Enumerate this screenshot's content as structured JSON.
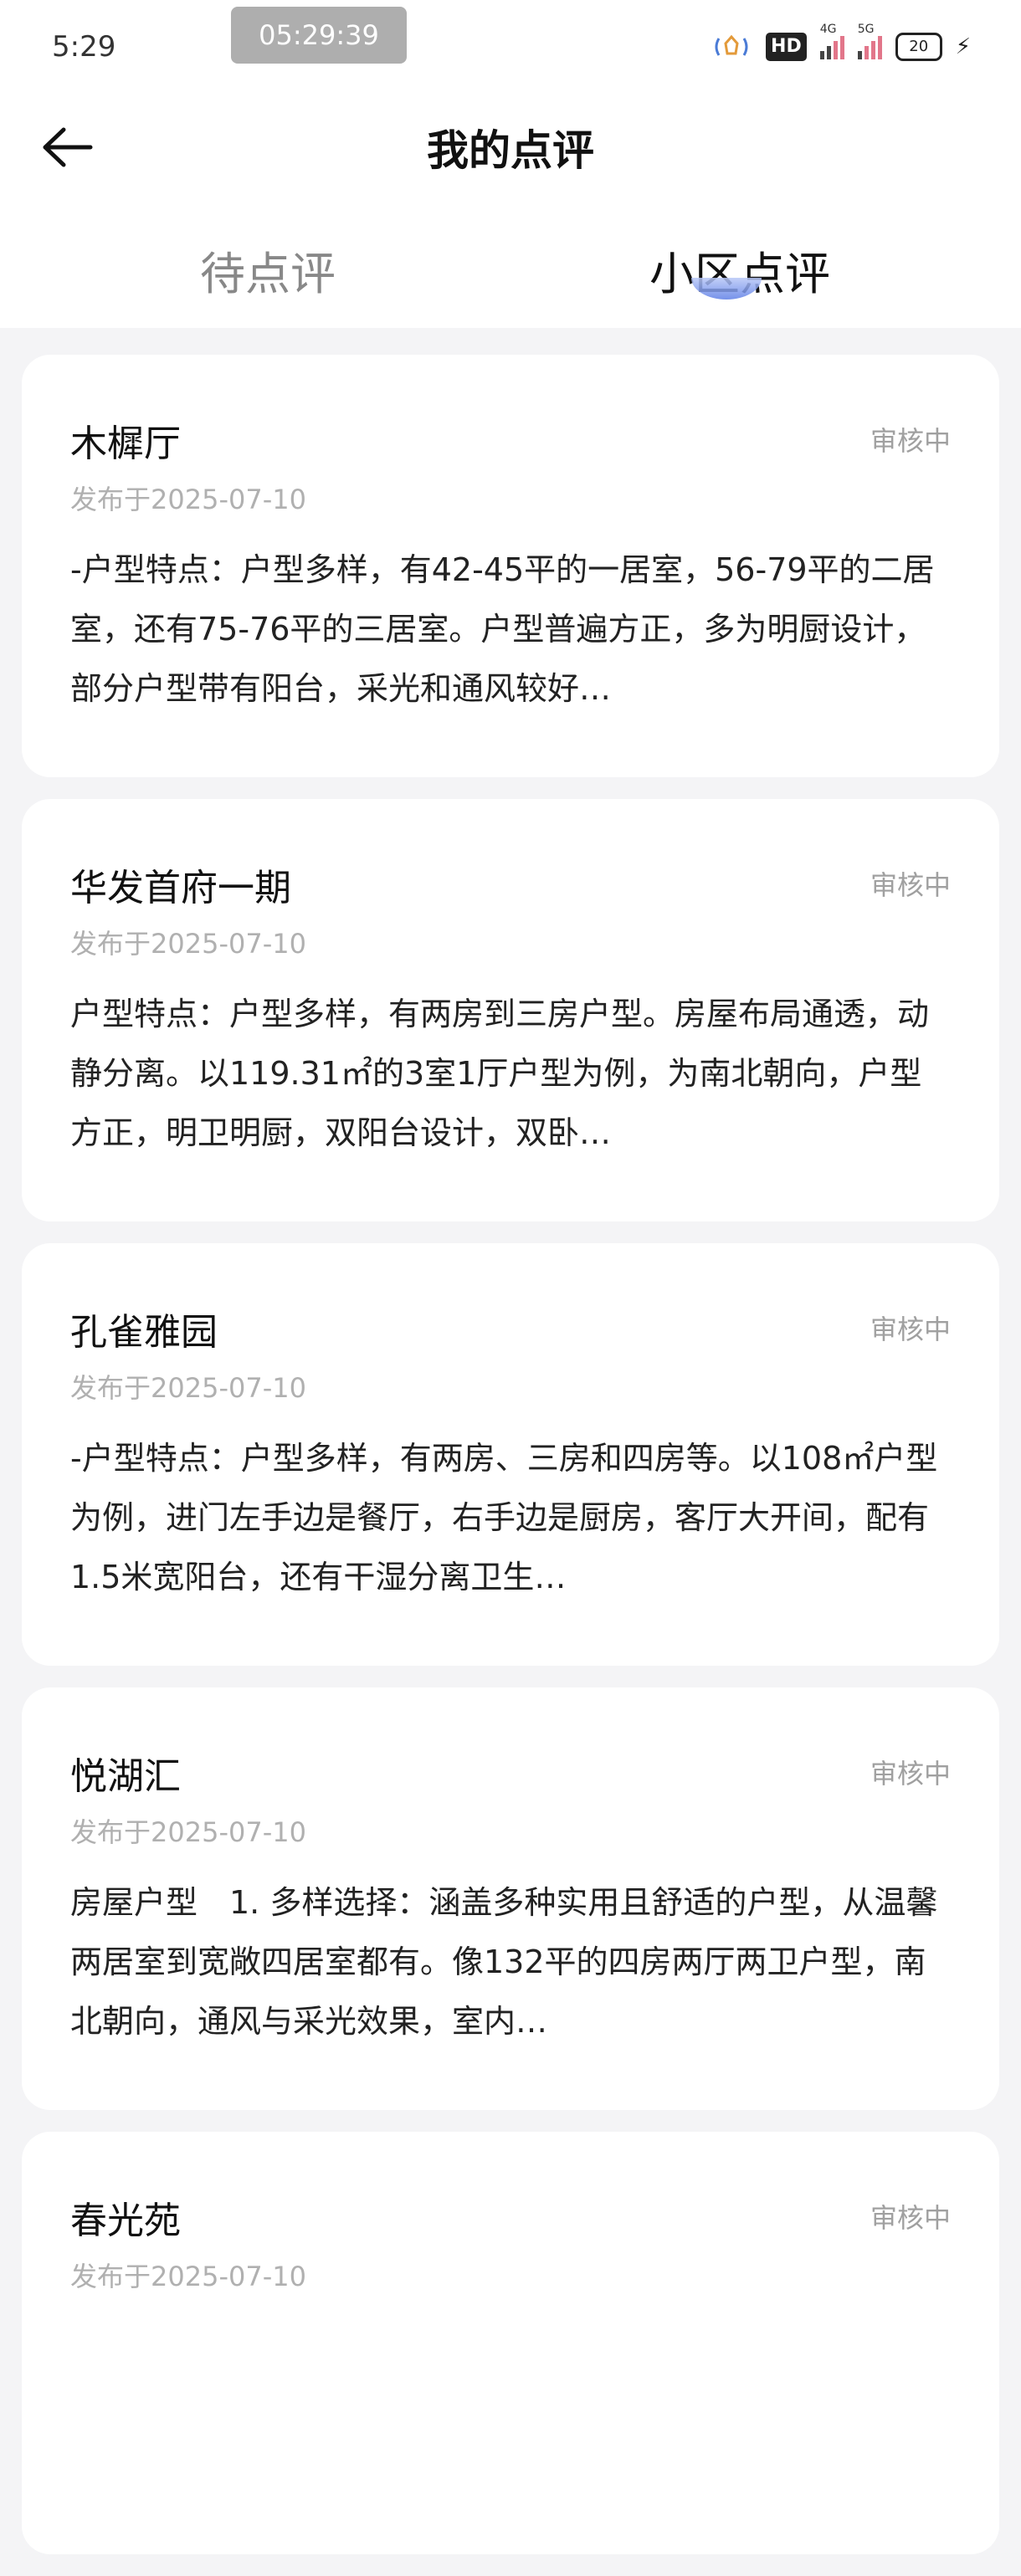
{
  "status_bar": {
    "time": "5:29",
    "recording_time": "05:29:39",
    "hd_label": "HD",
    "net1": "4G",
    "net2": "5G",
    "battery": "20"
  },
  "header": {
    "title": "我的点评"
  },
  "tabs": [
    {
      "label": "待点评",
      "active": false
    },
    {
      "label": "小区点评",
      "active": true
    }
  ],
  "colors": {
    "accent": "#5d7ee6",
    "background": "#f4f4f6",
    "status_text": "#a0a0a0"
  },
  "reviews": [
    {
      "name": "木樨厅",
      "status": "审核中",
      "date": "发布于2025-07-10",
      "text": "-户型特点：户型多样，有42-45平的一居室，56-79平的二居室，还有75-76平的三居室。户型普遍方正，多为明厨设计，部分户型带有阳台，采光和通风较好…"
    },
    {
      "name": "华发首府一期",
      "status": "审核中",
      "date": "发布于2025-07-10",
      "text": "户型特点：户型多样，有两房到三房户型。房屋布局通透，动静分离。以119.31㎡的3室1厅户型为例，为南北朝向，户型方正，明卫明厨，双阳台设计，双卧…"
    },
    {
      "name": "孔雀雅园",
      "status": "审核中",
      "date": "发布于2025-07-10",
      "text": "-户型特点：户型多样，有两房、三房和四房等。以108㎡户型为例，进门左手边是餐厅，右手边是厨房，客厅大开间，配有1.5米宽阳台，还有干湿分离卫生…"
    },
    {
      "name": "悦湖汇",
      "status": "审核中",
      "date": "发布于2025-07-10",
      "text": "房屋户型　1. 多样选择：涵盖多种实用且舒适的户型，从温馨两居室到宽敞四居室都有。像132平的四房两厅两卫户型，南北朝向，通风与采光效果，室内…"
    },
    {
      "name": "春光苑",
      "status": "审核中",
      "date": "发布于2025-07-10",
      "text": ""
    }
  ]
}
